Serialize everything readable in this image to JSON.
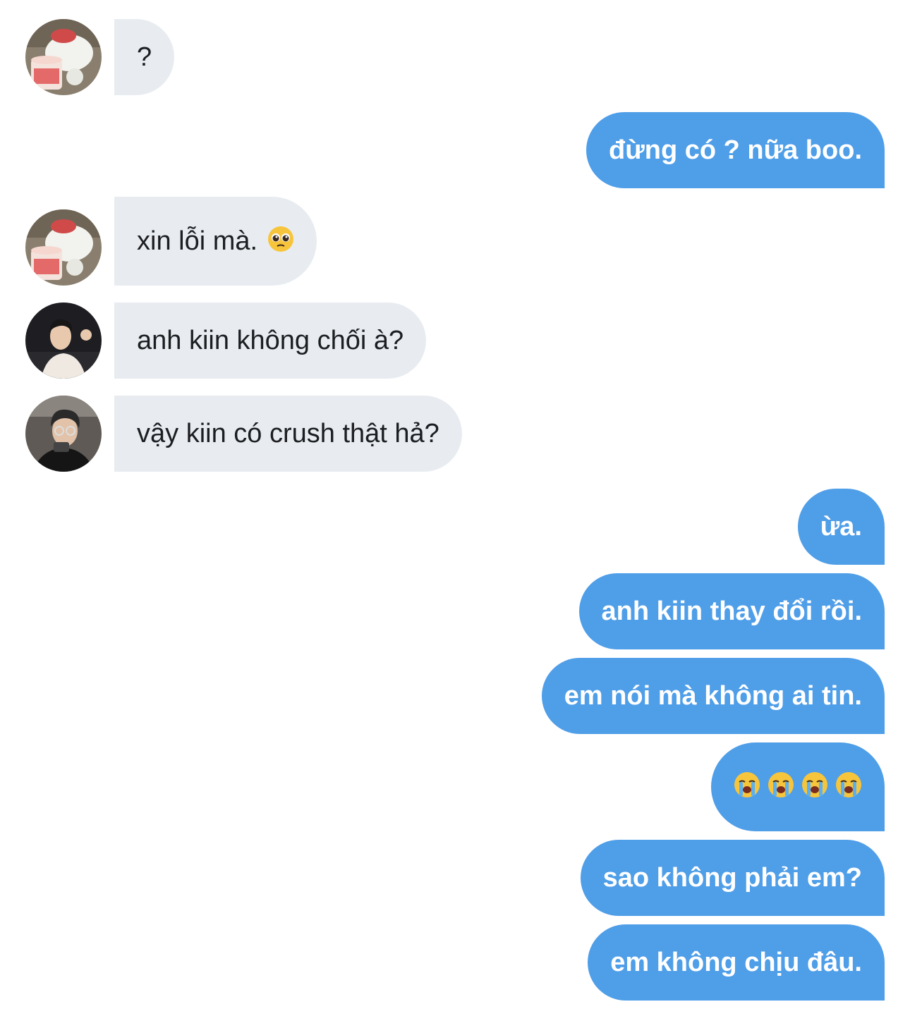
{
  "colors": {
    "incoming_bubble": "#e8ecf0",
    "outgoing_bubble": "#4f9ee8",
    "incoming_text": "#1c1e21",
    "outgoing_text": "#ffffff"
  },
  "messages": [
    {
      "direction": "incoming",
      "avatar": "bear-ice-cream-avatar",
      "text": "?"
    },
    {
      "direction": "outgoing",
      "text": "đừng có ? nữa boo."
    },
    {
      "direction": "incoming",
      "avatar": "bear-ice-cream-avatar",
      "text": "xin lỗi mà.",
      "emoji": "pleading-face-emoji"
    },
    {
      "direction": "incoming",
      "avatar": "person-white-shirt-avatar",
      "text": "anh kiin không chối à?"
    },
    {
      "direction": "incoming",
      "avatar": "person-glasses-avatar",
      "text": "vậy kiin có crush thật hả?"
    },
    {
      "direction": "outgoing",
      "text": "ừa."
    },
    {
      "direction": "outgoing",
      "text": "anh kiin thay đổi rồi."
    },
    {
      "direction": "outgoing",
      "text": "em nói mà không ai tin."
    },
    {
      "direction": "outgoing",
      "emoji": "loudly-crying-face-emoji",
      "emoji_count": 4
    },
    {
      "direction": "outgoing",
      "text": "sao không phải em?"
    },
    {
      "direction": "outgoing",
      "text": "em không chịu đâu."
    }
  ]
}
